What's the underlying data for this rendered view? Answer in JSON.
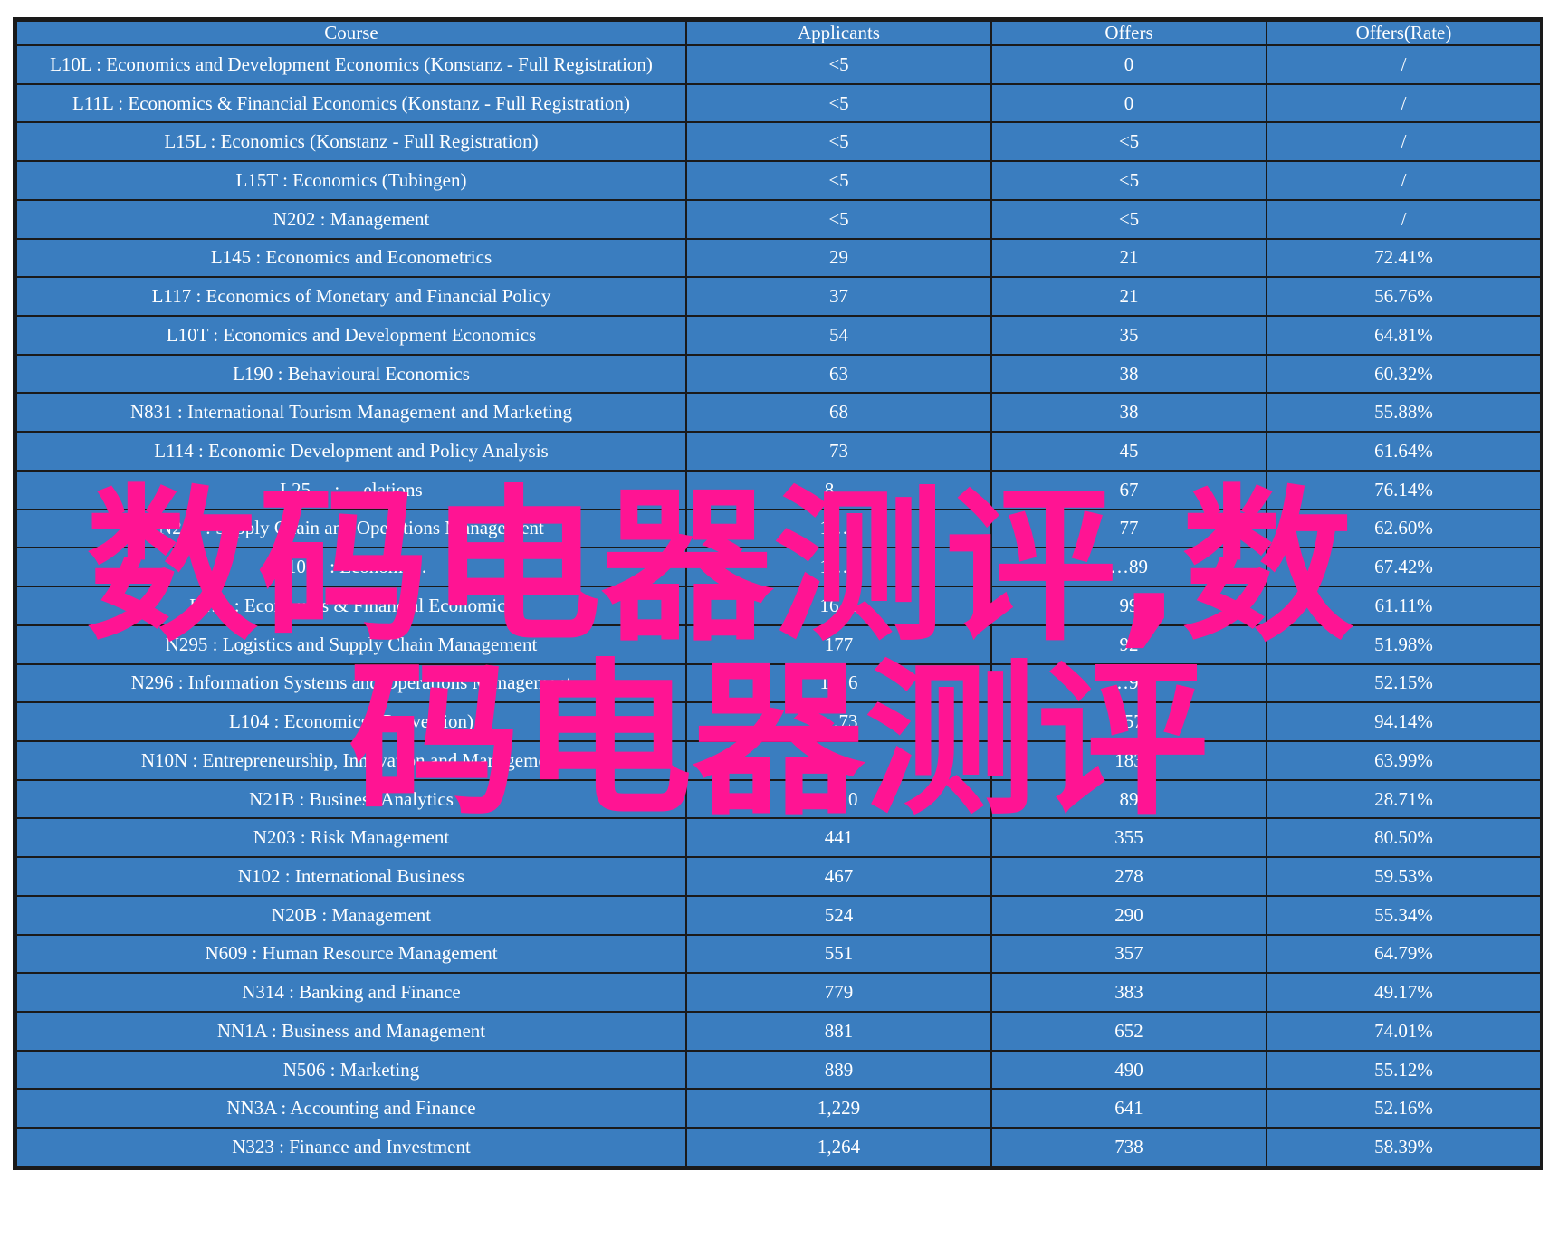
{
  "table": {
    "headers": [
      "Course",
      "Applicants",
      "Offers",
      "Offers(Rate)"
    ],
    "rows": [
      {
        "course": "L10L : Economics and Development Economics (Konstanz - Full Registration)",
        "applicants": "<5",
        "offers": "0",
        "rate": "/",
        "course_color": "white",
        "applicants_color": "white",
        "rate_color": "white"
      },
      {
        "course": "L11L : Economics & Financial Economics (Konstanz - Full Registration)",
        "applicants": "<5",
        "offers": "0",
        "rate": "/",
        "course_color": "white",
        "applicants_color": "white",
        "rate_color": "white"
      },
      {
        "course": "L15L : Economics (Konstanz - Full Registration)",
        "applicants": "<5",
        "offers": "<5",
        "rate": "/",
        "course_color": "white",
        "applicants_color": "white",
        "rate_color": "white"
      },
      {
        "course": "L15T : Economics (Tubingen)",
        "applicants": "<5",
        "offers": "<5",
        "rate": "/",
        "course_color": "white",
        "applicants_color": "white",
        "rate_color": "white"
      },
      {
        "course": "N202 : Management",
        "applicants": "<5",
        "offers": "<5",
        "rate": "/",
        "course_color": "white",
        "applicants_color": "white",
        "rate_color": "white"
      },
      {
        "course": "L145 : Economics and Econometrics",
        "applicants": "29",
        "offers": "21",
        "rate": "72.41%",
        "course_color": "white",
        "applicants_color": "white",
        "rate_color": "red"
      },
      {
        "course": "L117 : Economics of Monetary and Financial Policy",
        "applicants": "37",
        "offers": "21",
        "rate": "56.76%",
        "course_color": "white",
        "applicants_color": "white",
        "rate_color": "white"
      },
      {
        "course": "L10T : Economics and Development Economics",
        "applicants": "54",
        "offers": "35",
        "rate": "64.81%",
        "course_color": "white",
        "applicants_color": "white",
        "rate_color": "white"
      },
      {
        "course": "L190 : Behavioural Economics",
        "applicants": "63",
        "offers": "38",
        "rate": "60.32%",
        "course_color": "white",
        "applicants_color": "white",
        "rate_color": "white"
      },
      {
        "course": "N831 : International Tourism Management and Marketing",
        "applicants": "68",
        "offers": "38",
        "rate": "55.88%",
        "course_color": "white",
        "applicants_color": "white",
        "rate_color": "white"
      },
      {
        "course": "L114 : Economic Development and Policy Analysis",
        "applicants": "73",
        "offers": "45",
        "rate": "61.64%",
        "course_color": "white",
        "applicants_color": "white",
        "rate_color": "white"
      },
      {
        "course": "L25… : …elations",
        "applicants": "8…",
        "offers": "67",
        "rate": "76.14%",
        "course_color": "white",
        "applicants_color": "white",
        "rate_color": "red"
      },
      {
        "course": "N2… : Supply Chain and Operations Management",
        "applicants": "1…3",
        "offers": "77",
        "rate": "62.60%",
        "course_color": "white",
        "applicants_color": "white",
        "rate_color": "white"
      },
      {
        "course": "L10… : Economi…",
        "applicants": "1…2",
        "offers": "…89",
        "rate": "67.42%",
        "course_color": "white",
        "applicants_color": "white",
        "rate_color": "white"
      },
      {
        "course": "L1… : Economics & Financial Economics",
        "applicants": "16…",
        "offers": "99",
        "rate": "61.11%",
        "course_color": "white",
        "applicants_color": "white",
        "rate_color": "white"
      },
      {
        "course": "N295 : Logistics and Supply Chain Management",
        "applicants": "177",
        "offers": "92",
        "rate": "51.98%",
        "course_color": "white",
        "applicants_color": "white",
        "rate_color": "white"
      },
      {
        "course": "N296 : Information Systems and Operations Management",
        "applicants": "1…6",
        "offers": "…97",
        "rate": "52.15%",
        "course_color": "white",
        "applicants_color": "white",
        "rate_color": "white"
      },
      {
        "course": "L104 : Economics (Conversion)",
        "applicants": "…73",
        "offers": "257",
        "rate": "94.14%",
        "course_color": "white",
        "applicants_color": "white",
        "rate_color": "red"
      },
      {
        "course": "N10N : Entrepreneurship, Innovation and Management",
        "applicants": "…",
        "offers": "183",
        "rate": "63.99%",
        "course_color": "white",
        "applicants_color": "white",
        "rate_color": "white"
      },
      {
        "course": "N21B : Business Analytics",
        "applicants": "…10",
        "offers": "89",
        "rate": "28.71%",
        "course_color": "white",
        "applicants_color": "white",
        "rate_color": "white"
      },
      {
        "course": "N203 : Risk Management",
        "applicants": "441",
        "offers": "355",
        "rate": "80.50%",
        "course_color": "white",
        "applicants_color": "white",
        "rate_color": "red"
      },
      {
        "course": "N102 : International Business",
        "applicants": "467",
        "offers": "278",
        "rate": "59.53%",
        "course_color": "white",
        "applicants_color": "white",
        "rate_color": "white"
      },
      {
        "course": "N20B : Management",
        "applicants": "524",
        "offers": "290",
        "rate": "55.34%",
        "course_color": "yellow",
        "applicants_color": "yellow",
        "rate_color": "white"
      },
      {
        "course": "N609 : Human Resource Management",
        "applicants": "551",
        "offers": "357",
        "rate": "64.79%",
        "course_color": "yellow",
        "applicants_color": "yellow",
        "rate_color": "white"
      },
      {
        "course": "N314 : Banking and Finance",
        "applicants": "779",
        "offers": "383",
        "rate": "49.17%",
        "course_color": "yellow",
        "applicants_color": "yellow",
        "rate_color": "white"
      },
      {
        "course": "NN1A : Business and Management",
        "applicants": "881",
        "offers": "652",
        "rate": "74.01%",
        "course_color": "yellow",
        "applicants_color": "yellow",
        "rate_color": "red"
      },
      {
        "course": "N506 : Marketing",
        "applicants": "889",
        "offers": "490",
        "rate": "55.12%",
        "course_color": "yellow",
        "applicants_color": "yellow",
        "rate_color": "white"
      },
      {
        "course": "NN3A : Accounting and Finance",
        "applicants": "1,229",
        "offers": "641",
        "rate": "52.16%",
        "course_color": "yellow",
        "applicants_color": "yellow",
        "rate_color": "white"
      },
      {
        "course": "N323 : Finance and Investment",
        "applicants": "1,264",
        "offers": "738",
        "rate": "58.39%",
        "course_color": "yellow",
        "applicants_color": "yellow",
        "rate_color": "white"
      }
    ]
  },
  "watermark": {
    "line1": "数码电器测评,数",
    "line2": "码电器测评",
    "color": "#ff1493"
  },
  "colors": {
    "cell_background": "#3a7dbf",
    "border": "#1a1a1a",
    "text_default": "#ffffff",
    "text_highlight_yellow": "#f5f52a",
    "text_highlight_red": "#e8242a"
  }
}
